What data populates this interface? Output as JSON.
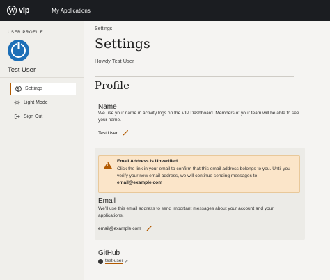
{
  "topbar": {
    "logo_glyph": "W",
    "logo_text": "vip",
    "nav_label": "My Applications"
  },
  "sidebar": {
    "section_label": "USER PROFILE",
    "username": "Test User",
    "items": [
      {
        "label": "Settings",
        "icon": "user-circle-icon",
        "active": true
      },
      {
        "label": "Light Mode",
        "icon": "sun-icon",
        "active": false
      },
      {
        "label": "Sign Out",
        "icon": "sign-out-icon",
        "active": false
      }
    ]
  },
  "main": {
    "breadcrumb": "Settings",
    "title": "Settings",
    "greeting": "Howdy Test User",
    "section_title": "Profile",
    "name": {
      "title": "Name",
      "description": "We use your name in activity logs on the VIP Dashboard. Members of your team will be able to see your name.",
      "value": "Test User"
    },
    "warning": {
      "title": "Email Address is Unverified",
      "text": "Click the link in your email to confirm that this email address belongs to you. Until you verify your new email address, we will continue sending messages to",
      "email": "email@example.com"
    },
    "email": {
      "title": "Email",
      "description": "We’ll use this email address to send important messages about your account and your applications.",
      "value": "email@example.com"
    },
    "github": {
      "title": "GitHub",
      "username": "test-user",
      "arrow": "↗"
    }
  },
  "colors": {
    "topbar_bg": "#1b1d21",
    "accent": "#b35a00",
    "warning_bg": "#fbe5c9",
    "avatar": "#1d6fb7"
  }
}
